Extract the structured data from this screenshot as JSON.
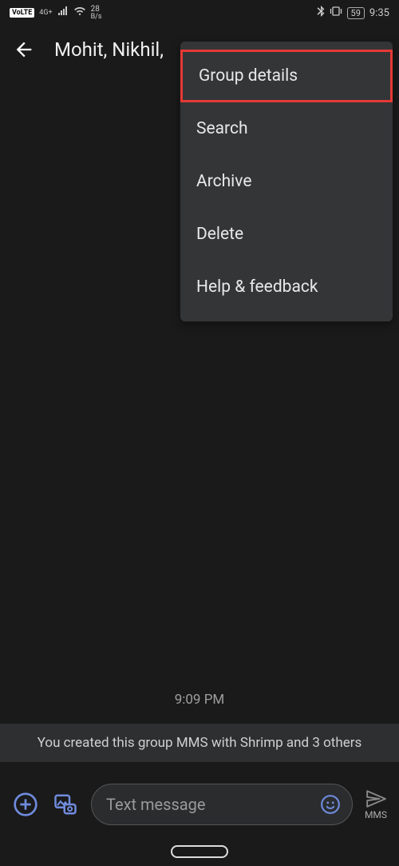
{
  "status": {
    "volte": "VoLTE",
    "network_gen": "4G+",
    "data_speed_value": "28",
    "data_speed_unit": "B/s",
    "battery": "59",
    "time": "9:35"
  },
  "header": {
    "title": "Mohit, Nikhil,"
  },
  "menu": {
    "items": [
      {
        "label": "Group details",
        "highlighted": true
      },
      {
        "label": "Search",
        "highlighted": false
      },
      {
        "label": "Archive",
        "highlighted": false
      },
      {
        "label": "Delete",
        "highlighted": false
      },
      {
        "label": "Help & feedback",
        "highlighted": false
      }
    ]
  },
  "conversation": {
    "timestamp": "9:09 PM",
    "info_text": "You created this group MMS with Shrimp  and 3 others"
  },
  "compose": {
    "placeholder": "Text message",
    "send_label": "MMS"
  }
}
